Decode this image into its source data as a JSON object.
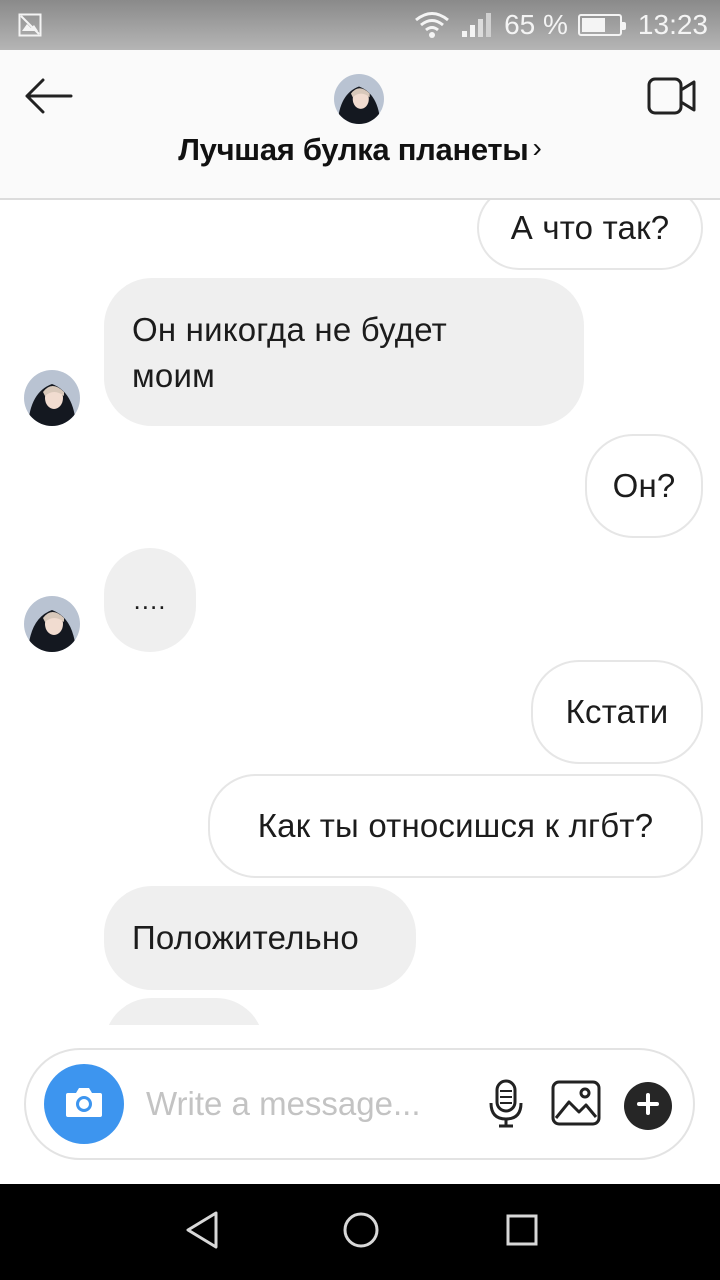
{
  "status_bar": {
    "battery": "65 %",
    "battery_level": 0.65,
    "time": "13:23",
    "icons": [
      "image-icon",
      "wifi-icon",
      "signal-icon",
      "battery-icon"
    ]
  },
  "header": {
    "title": "Лучшая булка планеты",
    "chevron": "›",
    "icons": [
      "back-arrow-icon",
      "video-call-icon"
    ]
  },
  "messages": [
    {
      "side": "out",
      "text": "А что так?"
    },
    {
      "side": "in",
      "text": "Он никогда не будет моим"
    },
    {
      "side": "out",
      "text": "Он?"
    },
    {
      "side": "in",
      "text": "...."
    },
    {
      "side": "out",
      "text": "Кстати"
    },
    {
      "side": "out",
      "text": "Как ты относишся к лгбт?"
    },
    {
      "side": "in",
      "text": "Положительно"
    }
  ],
  "composer": {
    "placeholder": "Write a message...",
    "icons": [
      "camera-icon",
      "microphone-icon",
      "gallery-icon",
      "plus-icon"
    ]
  },
  "colors": {
    "accent": "#3d95ef",
    "incoming_bubble": "#efefef",
    "outgoing_border": "#e6e6e6"
  },
  "nav_bar": {
    "icons": [
      "back-triangle-icon",
      "home-circle-icon",
      "recents-square-icon"
    ]
  }
}
